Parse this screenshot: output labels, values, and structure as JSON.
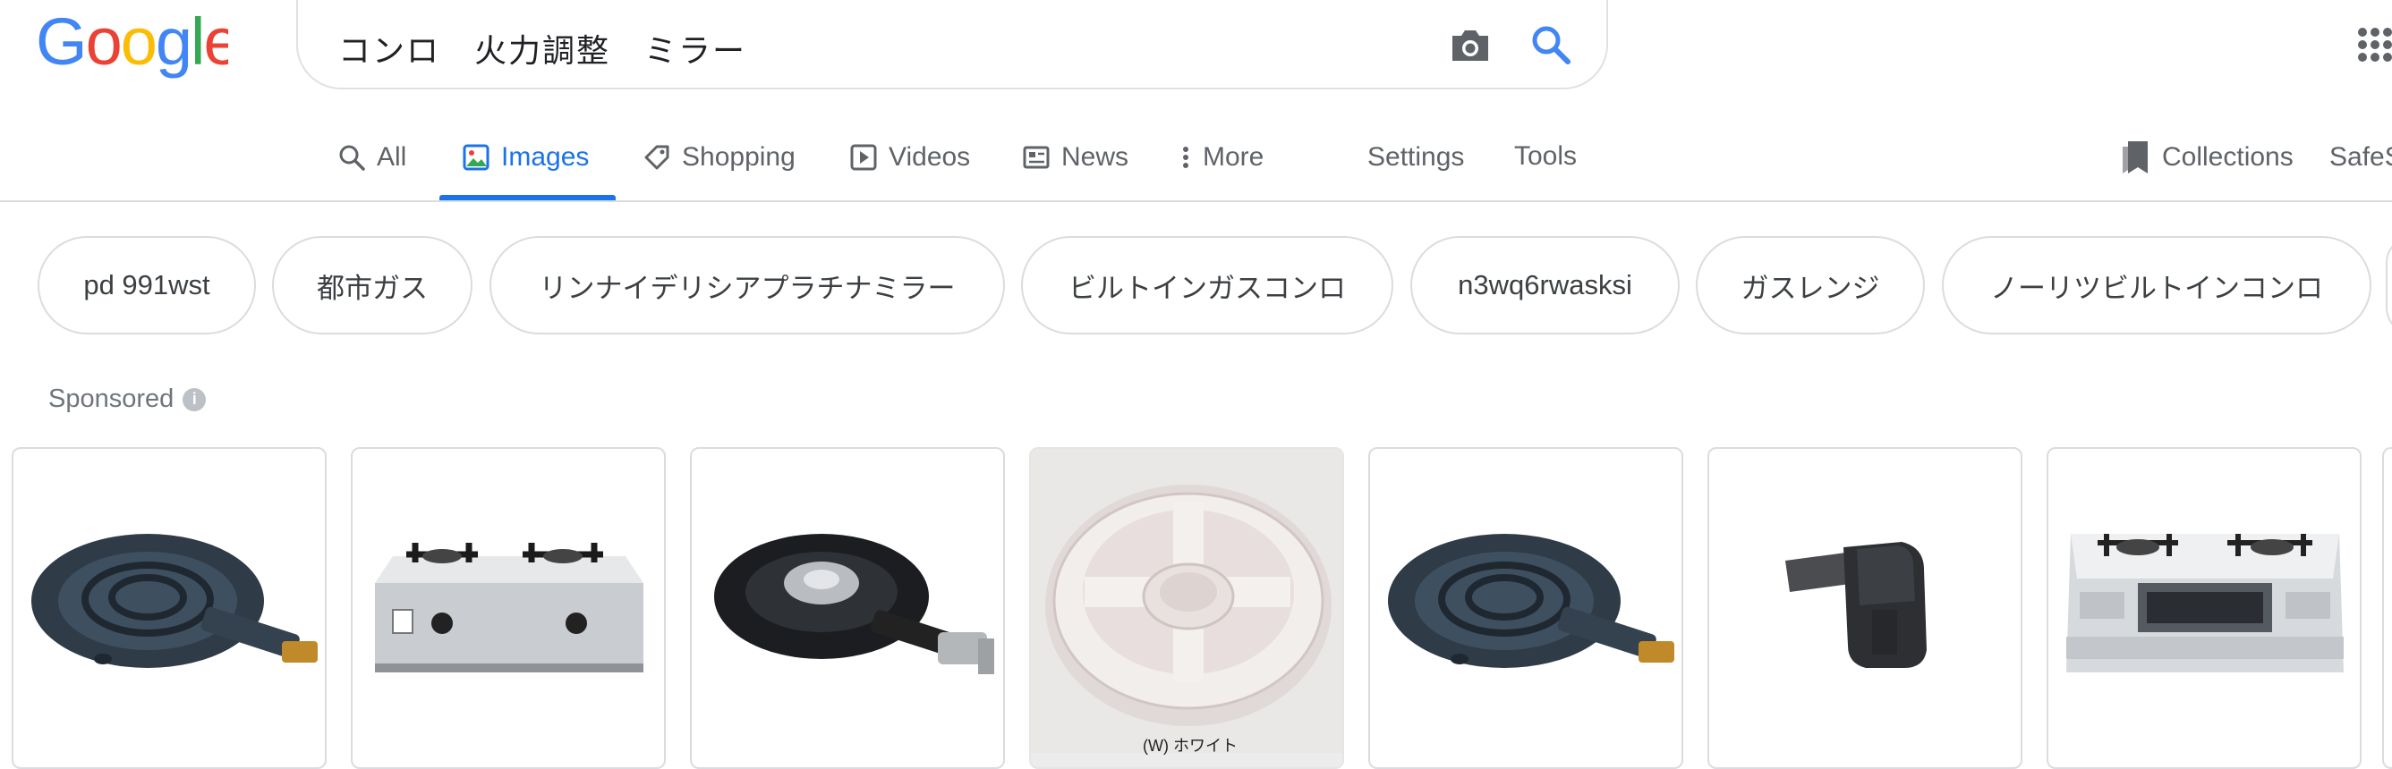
{
  "search": {
    "query": "コンロ　火力調整　ミラー"
  },
  "tabs": [
    {
      "label": "All",
      "icon": "search-icon",
      "active": false
    },
    {
      "label": "Images",
      "icon": "image-icon",
      "active": true
    },
    {
      "label": "Shopping",
      "icon": "tag-icon",
      "active": false
    },
    {
      "label": "Videos",
      "icon": "play-icon",
      "active": false
    },
    {
      "label": "News",
      "icon": "news-icon",
      "active": false
    },
    {
      "label": "More",
      "icon": "more-vertical-icon",
      "active": false
    }
  ],
  "tools": {
    "settings": "Settings",
    "tools": "Tools",
    "collections": "Collections",
    "safesearch": "SafeS"
  },
  "chips": [
    "pd 991wst",
    "都市ガス",
    "リンナイデリシアプラチナミラー",
    "ビルトインガスコンロ",
    "n3wq6rwasksi",
    "ガスレンジ",
    "ノーリツビルトインコンロ"
  ],
  "sponsored": {
    "label": "Sponsored",
    "info": "i"
  },
  "products": [
    {
      "image": "cast-iron-ring-burner"
    },
    {
      "image": "two-burner-table-stove"
    },
    {
      "image": "cast-iron-burner-with-valve"
    },
    {
      "image": "white-ceramic-burner-ring",
      "caption": "(W) ホワイト"
    },
    {
      "image": "cast-iron-ring-burner"
    },
    {
      "image": "black-knob-part"
    },
    {
      "image": "builtin-gas-cooktop"
    }
  ],
  "colors": {
    "accent": "#1a73e8",
    "border": "#dadce0",
    "muted": "#5f6368"
  }
}
